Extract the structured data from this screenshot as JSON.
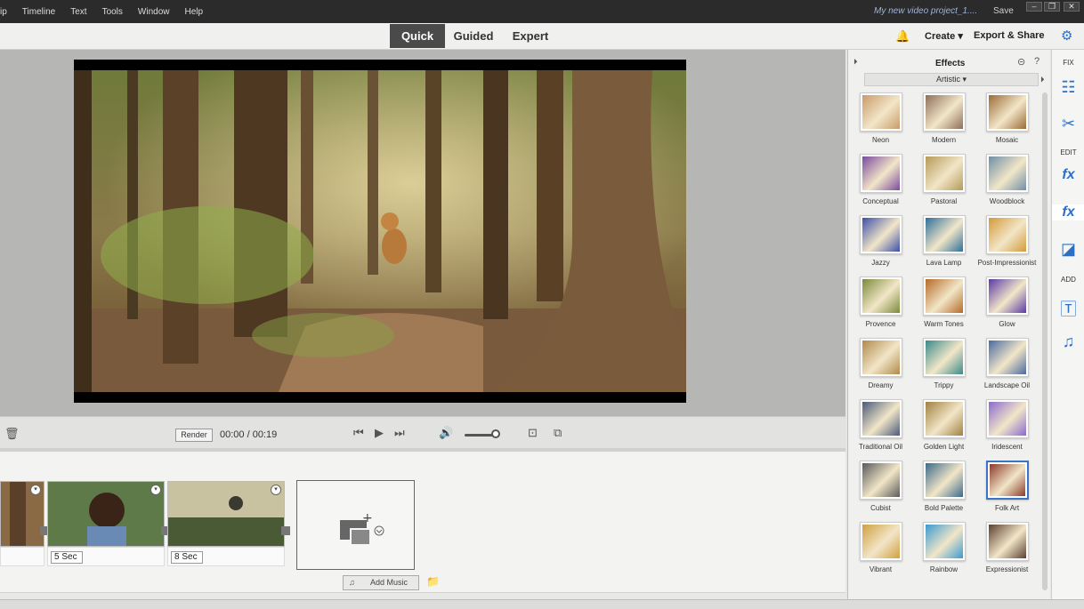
{
  "menu": [
    "ip",
    "Timeline",
    "Text",
    "Tools",
    "Window",
    "Help"
  ],
  "window": {
    "title": "My new video project_1....",
    "save": "Save",
    "min": "–",
    "max": "❐",
    "close": "✕"
  },
  "modes": [
    "Quick",
    "Guided",
    "Expert"
  ],
  "header": {
    "create": "Create",
    "export": "Export & Share"
  },
  "playback": {
    "render": "Render",
    "time": "00:00 / 00:19"
  },
  "clips": [
    {
      "duration": ""
    },
    {
      "duration": "5 Sec"
    },
    {
      "duration": "8 Sec"
    }
  ],
  "timeline": {
    "add_music": "Add Music"
  },
  "effects": {
    "title": "Effects",
    "filter": "Artistic",
    "items": [
      {
        "label": "Neon",
        "color": "#c89b6a"
      },
      {
        "label": "Modern",
        "color": "#8e6e5a"
      },
      {
        "label": "Mosaic",
        "color": "#9b6b38"
      },
      {
        "label": "Conceptual",
        "color": "#7a4a9e"
      },
      {
        "label": "Pastoral",
        "color": "#b59a58"
      },
      {
        "label": "Woodblock",
        "color": "#6f8fa6"
      },
      {
        "label": "Jazzy",
        "color": "#3d4fa8"
      },
      {
        "label": "Lava Lamp",
        "color": "#2e6f9a"
      },
      {
        "label": "Post-Impressionist",
        "color": "#d39a3a"
      },
      {
        "label": "Provence",
        "color": "#7a8a3a"
      },
      {
        "label": "Warm Tones",
        "color": "#b56a26"
      },
      {
        "label": "Glow",
        "color": "#5a3aa6"
      },
      {
        "label": "Dreamy",
        "color": "#b08a4a"
      },
      {
        "label": "Trippy",
        "color": "#3a8a8a"
      },
      {
        "label": "Landscape Oil",
        "color": "#4a6aa0"
      },
      {
        "label": "Traditional Oil",
        "color": "#4a5a7a"
      },
      {
        "label": "Golden Light",
        "color": "#a08040"
      },
      {
        "label": "Iridescent",
        "color": "#8a6ad0"
      },
      {
        "label": "Cubist",
        "color": "#5a5a5a"
      },
      {
        "label": "Bold Palette",
        "color": "#3a6a8a"
      },
      {
        "label": "Folk Art",
        "color": "#8a3a2a"
      },
      {
        "label": "Vibrant",
        "color": "#d0a040"
      },
      {
        "label": "Rainbow",
        "color": "#3a9ad0"
      },
      {
        "label": "Expressionist",
        "color": "#5a4030"
      }
    ]
  },
  "rail": {
    "fix": "FIX",
    "edit": "EDIT",
    "add": "ADD"
  }
}
